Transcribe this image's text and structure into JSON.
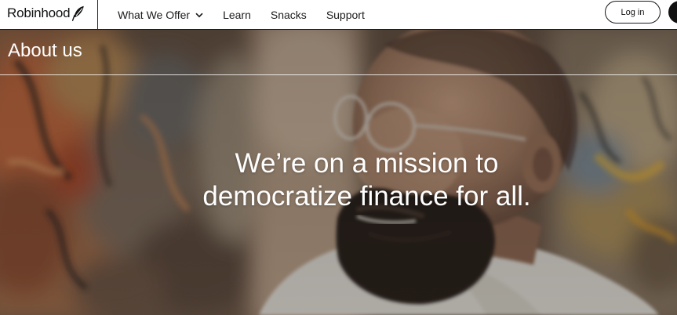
{
  "header": {
    "brand": "Robinhood",
    "logo_icon": "feather-icon",
    "nav": [
      {
        "label": "What We Offer",
        "has_dropdown": true
      },
      {
        "label": "Learn",
        "has_dropdown": false
      },
      {
        "label": "Snacks",
        "has_dropdown": false
      },
      {
        "label": "Support",
        "has_dropdown": false
      }
    ],
    "login_label": "Log in"
  },
  "hero": {
    "section_title": "About us",
    "headline_line1": "We’re on a mission to",
    "headline_line2": "democratize finance for all."
  },
  "colors": {
    "header_bg": "#ffffff",
    "text_dark": "#111111",
    "hero_text": "#ffffff",
    "signup_button": "#111111"
  }
}
